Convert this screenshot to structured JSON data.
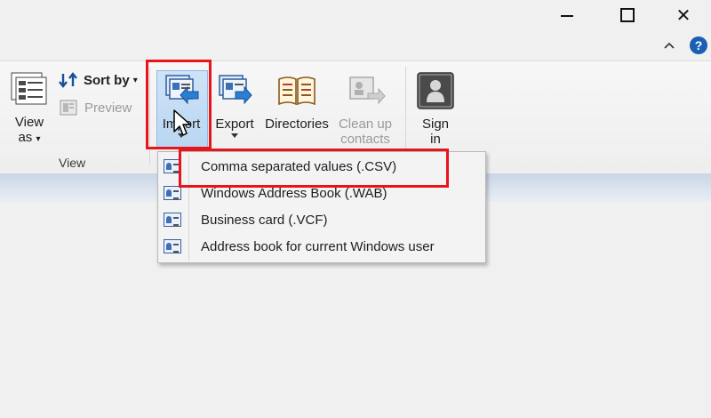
{
  "window": {
    "minimize_icon": "minimize-icon",
    "maximize_icon": "maximize-icon",
    "close_glyph": "✕",
    "help_glyph": "?"
  },
  "ribbon": {
    "view_group": {
      "label": "View",
      "view_as_line1": "View",
      "view_as_line2": "as",
      "sort_by": "Sort by",
      "preview": "Preview"
    },
    "buttons": {
      "import": "Import",
      "export": "Export",
      "directories": "Directories",
      "cleanup_line1": "Clean up",
      "cleanup_line2": "contacts",
      "signin_line1": "Sign",
      "signin_line2": "in"
    }
  },
  "import_menu": {
    "items": [
      {
        "label": "Comma separated values (.CSV)"
      },
      {
        "label": "Windows Address Book (.WAB)"
      },
      {
        "label": "Business card (.VCF)"
      },
      {
        "label": "Address book for current Windows user"
      }
    ]
  },
  "colors": {
    "annotation_red": "#e8141c",
    "accent_blue": "#1a5fb4",
    "selected_bg": "#c4dcf4"
  }
}
